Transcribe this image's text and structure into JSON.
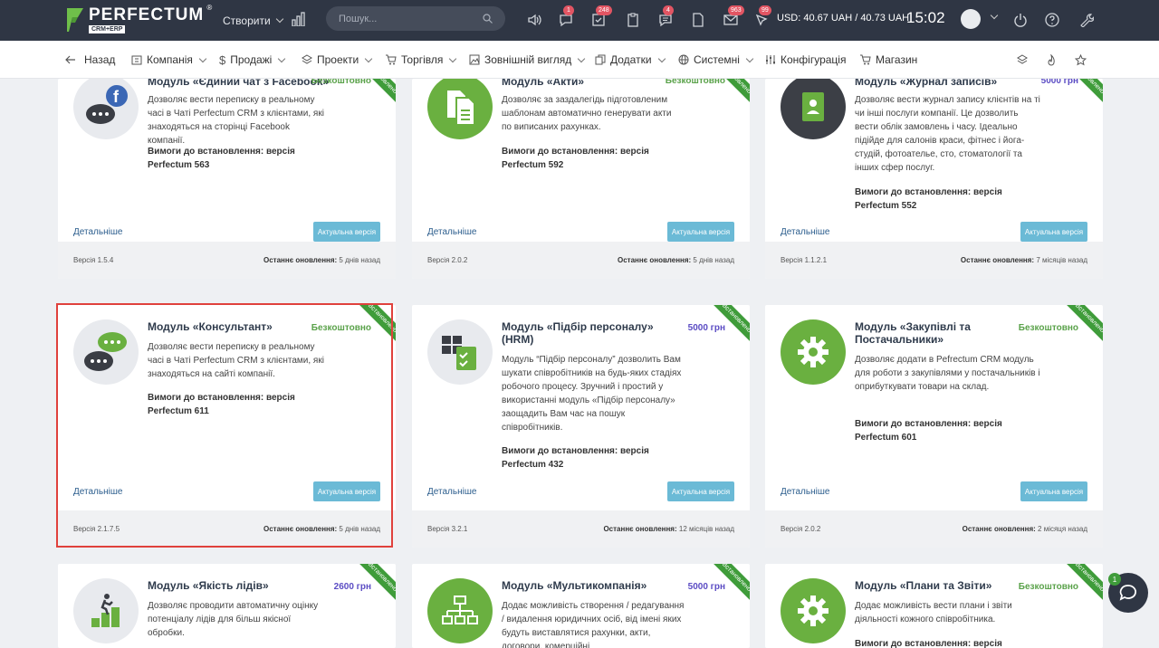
{
  "topbar": {
    "logo": "PERFECTUM",
    "logo_sub": "CRM+ERP",
    "create_label": "Створити",
    "search_placeholder": "Пошук...",
    "badges": {
      "chat": "1",
      "tasks": "248",
      "messages": "4",
      "mail": "963",
      "notifications": "99"
    },
    "currency": "USD: 40.67 UAH / 40.73 UAH",
    "time": "15:02"
  },
  "nav": {
    "back": "Назад",
    "company": "Компанія",
    "sales": "Продажі",
    "projects": "Проекти",
    "trade": "Торгівля",
    "appearance": "Зовнішній вигляд",
    "addons": "Додатки",
    "system": "Системні",
    "config": "Конфігурація",
    "store": "Магазин"
  },
  "common": {
    "more": "Детальніше",
    "actual": "Актуальна версія",
    "installed": "Встановлено",
    "last_update": "Останнє оновлення:"
  },
  "cards": [
    {
      "title": "Модуль «Єдиний чат з Facebook»",
      "price": "Безкоштовно",
      "desc": "Дозволяє вести переписку в реальному часі в Чаті Perfectum CRM з клієнтами, які знаходяться на сторінці Facebook компанії.",
      "req": "Вимоги до встановлення: версія Perfectum 563",
      "version": "Версія 1.5.4",
      "updated": "5 днів назад"
    },
    {
      "title": "Модуль «Акти»",
      "price": "Безкоштовно",
      "desc": "Дозволяє за заздалегідь підготовленим шаблонам автоматично генерувати акти по виписаних рахунках.",
      "req": "Вимоги до встановлення: версія Perfectum 592",
      "version": "Версія 2.0.2",
      "updated": "5 днів назад"
    },
    {
      "title": "Модуль «Журнал записів»",
      "price": "5000 грн",
      "desc": "Дозволяє вести журнал запису клієнтів на ті чи інші послуги компанії. Це дозволить вести облік замовлень і часу. Ідеально підійде для салонів краси, фітнес і йога-студій, фотоателье, сто, стоматології та інших сфер послуг.",
      "req": "Вимоги до встановлення: версія Perfectum 552",
      "version": "Версія 1.1.2.1",
      "updated": "7 місяців назад"
    },
    {
      "title": "Модуль «Консультант»",
      "price": "Безкоштовно",
      "desc": "Дозволяє вести переписку в реальному часі в Чаті Perfectum CRM з клієнтами, які знаходяться на сайті компанії.",
      "req": "Вимоги до встановлення: версія Perfectum 611",
      "version": "Версія 2.1.7.5",
      "updated": "5 днів назад"
    },
    {
      "title": "Модуль «Підбір персоналу» (HRM)",
      "price": "5000 грн",
      "desc": "Модуль “Підбір персоналу” дозволить Вам шукати співробітників на будь-яких стадіях робочого процесу. Зручний і простий у використанні модуль «Підбір персоналу» заощадить Вам час на пошук співробітників.",
      "req": "Вимоги до встановлення: версія Perfectum 432",
      "version": "Версія 3.2.1",
      "updated": "12 місяців назад"
    },
    {
      "title": "Модуль «Закупівлі та Постачальники»",
      "price": "Безкоштовно",
      "desc": "Дозволяє додати в Pefrectum CRM модуль для роботи з закупівлями у постачальників і оприбуткувати товари на склад.",
      "req": "Вимоги до встановлення: версія Perfectum 601",
      "version": "Версія 2.0.2",
      "updated": "2 місяця назад"
    },
    {
      "title": "Модуль «Якість лідів»",
      "price": "2600 грн",
      "desc": "Дозволяє проводити автоматичну оцінку потенціалу лідів для більш якісної обробки.",
      "req": "",
      "version": "",
      "updated": ""
    },
    {
      "title": "Модуль «Мультикомпанія»",
      "price": "5000 грн",
      "desc": "Додає можливість створення / редагування / видалення юридичних осіб, від імені яких будуть виставлятися рахунки, акти, договори, комерційні",
      "req": "",
      "version": "",
      "updated": ""
    },
    {
      "title": "Модуль «Плани та Звіти»",
      "price": "Безкоштовно",
      "desc": "Додає можливість вести плани і звіти діяльності кожного співробітника.",
      "req": "Вимоги до встановлення: версія",
      "version": "",
      "updated": ""
    }
  ],
  "chat_badge": "1",
  "colors": {
    "topbar": "#2f3644",
    "green": "#5aa24a",
    "ribbon": "#3f9c3a",
    "paid": "#5b4cc4",
    "button": "#6bbad6",
    "highlight": "#e0413c"
  }
}
